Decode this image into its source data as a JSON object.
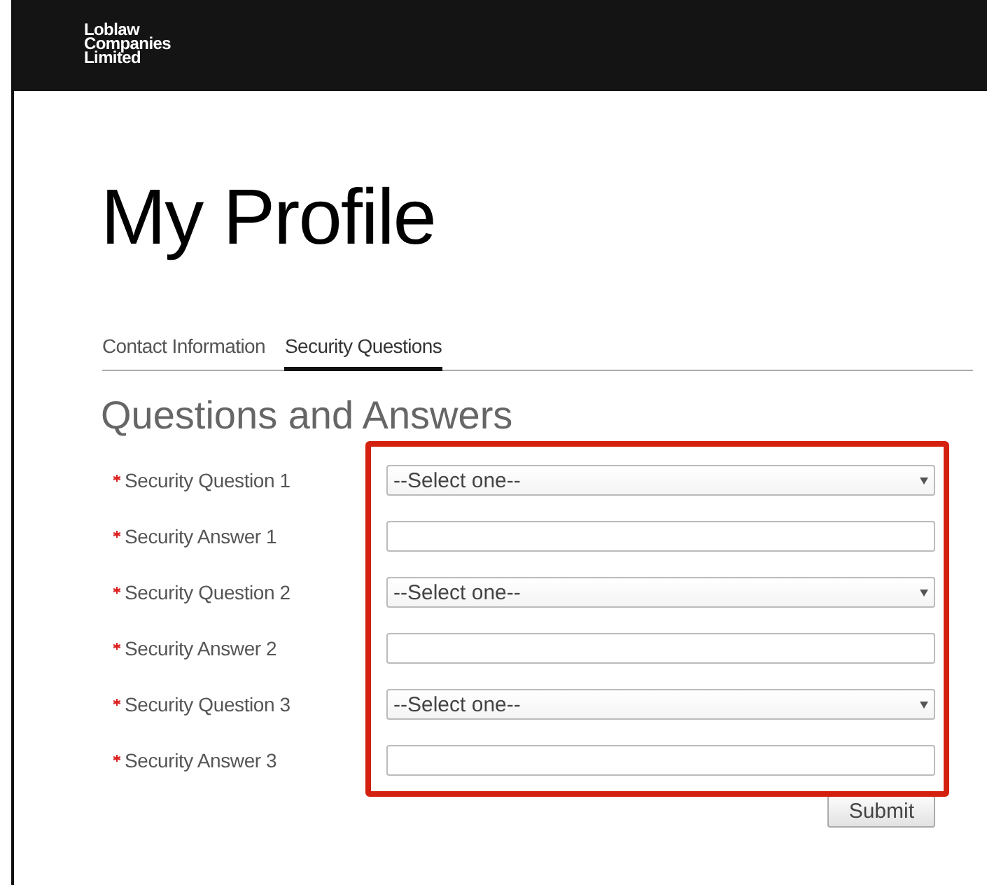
{
  "header": {
    "logo_lines": [
      "Loblaw",
      "Companies",
      "Limited"
    ]
  },
  "page_title": "My Profile",
  "tabs": [
    {
      "label": "Contact Information",
      "selected": false
    },
    {
      "label": "Security Questions",
      "selected": true
    }
  ],
  "section_title": "Questions and Answers",
  "highlighted": true,
  "fields": [
    {
      "kind": "select",
      "label": "Security Question 1",
      "required": true,
      "value": "--Select one--"
    },
    {
      "kind": "text",
      "label": "Security Answer 1",
      "required": true
    },
    {
      "kind": "select",
      "label": "Security Question 2",
      "required": true,
      "value": "--Select one--"
    },
    {
      "kind": "text",
      "label": "Security Answer 2",
      "required": true
    },
    {
      "kind": "select",
      "label": "Security Question 3",
      "required": true,
      "value": "--Select one--"
    },
    {
      "kind": "text",
      "label": "Security Answer 3",
      "required": true
    }
  ],
  "submit_button": "Submit"
}
